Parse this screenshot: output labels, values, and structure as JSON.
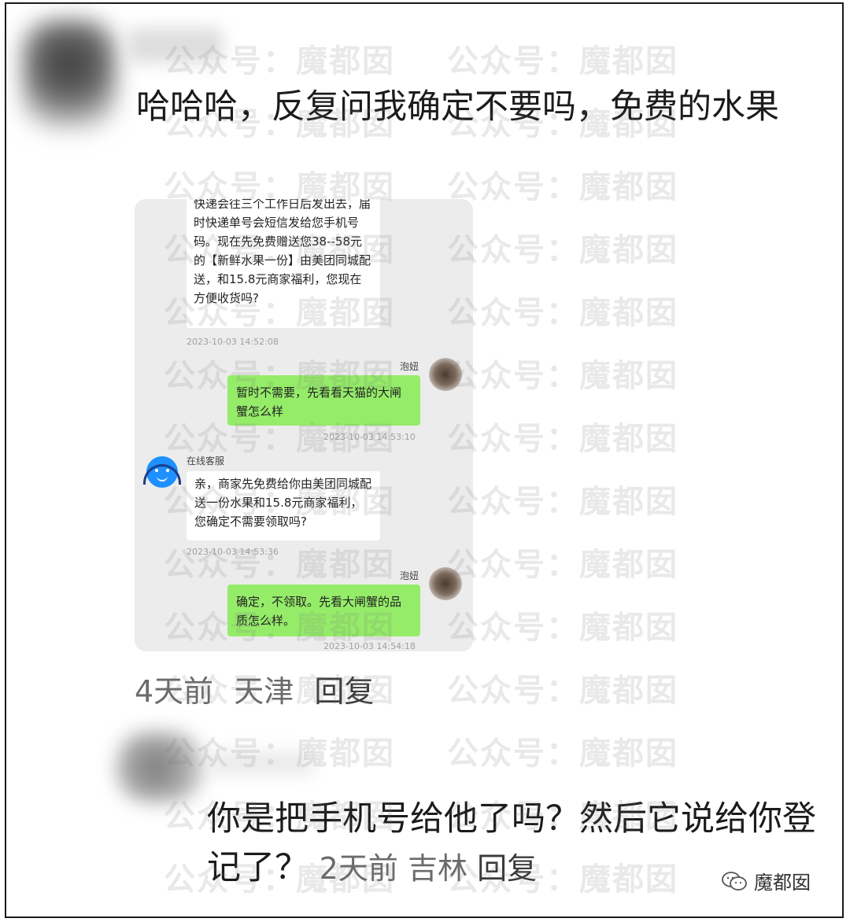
{
  "comment1": {
    "text": "哈哈哈，反复问我确定不要吗，免费的水果",
    "time": "4天前",
    "location": "天津",
    "reply_label": "回复"
  },
  "chat": {
    "msg1_text": "快递会往三个工作日后发出去，届时快递单号会短信发给您手机号码。现在先免费赠送您38--58元的【新鲜水果一份】由美团同城配送，和15.8元商家福利，您现在方便收货吗?",
    "msg1_time": "2023-10-03 14:52:08",
    "user_name": "泡妞",
    "msg2_text": "暂时不需要，先看看天猫的大闸蟹怎么样",
    "msg2_time": "2023-10-03 14:53:10",
    "cs_name": "在线客服",
    "msg3_text": "亲，商家先免费给你由美团同城配送一份水果和15.8元商家福利，您确定不需要领取吗?",
    "msg3_time": "2023-10-03 14:53:36",
    "user_name_2": "泡妞",
    "msg4_text": "确定，不领取。先看大闸蟹的品质怎么样。",
    "msg4_time": "2023-10-03 14:54:18"
  },
  "comment2": {
    "text": "你是把手机号给他了吗？然后它说给你登记了？",
    "time": "2天前",
    "location": "吉林",
    "reply_label": "回复"
  },
  "watermark": "公众号：魔都囡",
  "brand": {
    "name": "魔都囡",
    "icon": "wechat-icon"
  }
}
